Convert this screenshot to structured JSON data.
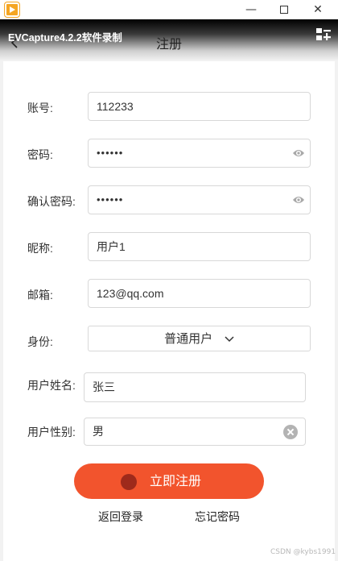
{
  "window": {
    "minimize_glyph": "—",
    "maximize_glyph": "",
    "close_glyph": "✕"
  },
  "header": {
    "recorder_label": "EVCapture4.2.2软件录制",
    "title": "注册"
  },
  "form": {
    "account": {
      "label": "账号:",
      "value": "112233"
    },
    "password": {
      "label": "密码:",
      "value": "••••••"
    },
    "confirm_password": {
      "label": "确认密码:",
      "value": "••••••"
    },
    "nickname": {
      "label": "昵称:",
      "value": "用户1"
    },
    "email": {
      "label": "邮箱:",
      "value": "123@qq.com"
    },
    "identity": {
      "label": "身份:",
      "value": "普通用户"
    },
    "real_name": {
      "label": "用户姓名:",
      "value": "张三"
    },
    "gender": {
      "label": "用户性别:",
      "value": "男"
    }
  },
  "actions": {
    "register": "立即注册",
    "back_to_login": "返回登录",
    "forgot_password": "忘记密码"
  },
  "watermark": "CSDN @kybs1991",
  "colors": {
    "accent": "#f2542d",
    "accent_dark": "#9e2a1b",
    "border": "#d8d8d8"
  }
}
